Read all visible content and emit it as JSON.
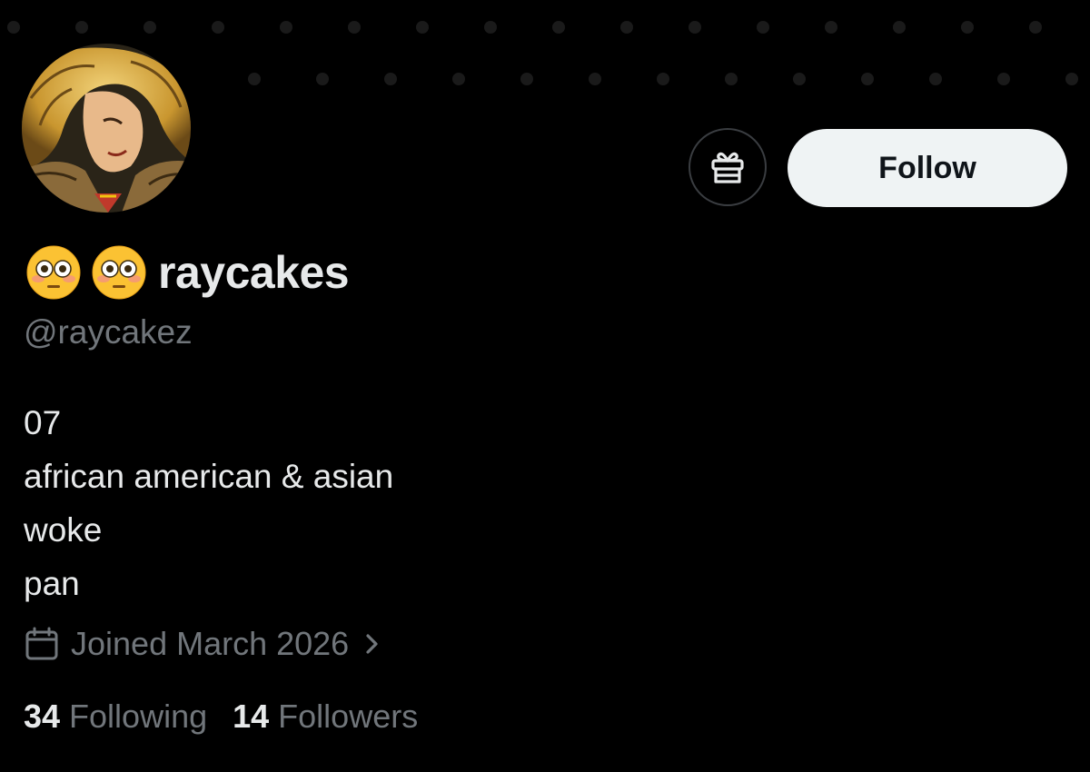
{
  "profile": {
    "display_name": "raycakes",
    "name_emojis": [
      "flushed-face-emoji",
      "flushed-face-emoji"
    ],
    "handle": "@raycakez",
    "bio_lines": [
      "07",
      "african american & asian",
      "woke",
      "pan"
    ],
    "joined": "Joined March 2026",
    "following_count": "34",
    "following_label": "Following",
    "followers_count": "14",
    "followers_label": "Followers"
  },
  "actions": {
    "follow_label": "Follow",
    "gift_icon": "gift-icon"
  },
  "icons": {
    "calendar": "calendar-icon",
    "chevron": "chevron-right-icon"
  },
  "colors": {
    "background": "#000000",
    "primary_text": "#e7e9ea",
    "secondary_text": "#71767b",
    "follow_button_bg": "#eff3f4",
    "follow_button_text": "#0f1419",
    "outline": "#3a3d41"
  }
}
